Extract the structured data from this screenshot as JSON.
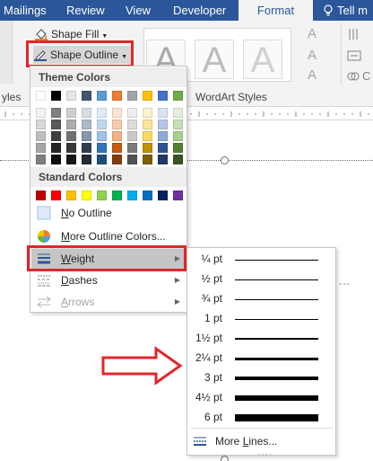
{
  "ribbon_tabs": [
    {
      "label": "Mailings",
      "active": false
    },
    {
      "label": "Review",
      "active": false
    },
    {
      "label": "View",
      "active": false
    },
    {
      "label": "Developer",
      "active": false
    },
    {
      "label": "Format",
      "active": true
    },
    {
      "label": "Tell m",
      "active": false
    }
  ],
  "ribbon": {
    "shape_fill_label": "Shape Fill",
    "shape_outline_label": "Shape Outline",
    "styles_group_label": "yles",
    "wordart_group_label": "WordArt Styles",
    "wordart_sample_letter": "A",
    "right_text_letter": "A",
    "right_align_letter": "C"
  },
  "theme_colors_header": "Theme Colors",
  "theme_colors_top": [
    "#ffffff",
    "#000000",
    "#e7e6e6",
    "#44546a",
    "#5b9bd5",
    "#ed7d31",
    "#a5a5a5",
    "#ffc000",
    "#4472c4",
    "#70ad47"
  ],
  "theme_colors_shades": [
    [
      "#f2f2f2",
      "#7f7f7f",
      "#d0cece",
      "#d6dce4",
      "#deebf6",
      "#fbe5d5",
      "#ededed",
      "#fff2cc",
      "#dae3f3",
      "#e2efd9"
    ],
    [
      "#d8d8d8",
      "#595959",
      "#aeabab",
      "#adb9ca",
      "#bdd7ee",
      "#f7cbac",
      "#dbdbdb",
      "#fee599",
      "#b4c6e7",
      "#c5e0b3"
    ],
    [
      "#bfbfbf",
      "#3f3f3f",
      "#757070",
      "#8496b0",
      "#9dc3e6",
      "#f4b183",
      "#c9c9c9",
      "#ffd965",
      "#8eaadb",
      "#a8d08d"
    ],
    [
      "#a5a5a5",
      "#262626",
      "#3a3838",
      "#323f4f",
      "#2e75b5",
      "#c55a11",
      "#7b7b7b",
      "#bf9000",
      "#2f5496",
      "#538135"
    ],
    [
      "#7f7f7f",
      "#0c0c0c",
      "#171616",
      "#222a35",
      "#1e4e79",
      "#843c0b",
      "#525252",
      "#7f6000",
      "#1f3864",
      "#375623"
    ]
  ],
  "standard_colors_header": "Standard Colors",
  "standard_colors": [
    "#c00000",
    "#ff0000",
    "#ffc000",
    "#ffff00",
    "#92d050",
    "#00b050",
    "#00b0f0",
    "#0070c0",
    "#002060",
    "#7030a0"
  ],
  "menu_items": {
    "no_outline": "No Outline",
    "more_outline_colors": "More Outline Colors...",
    "weight": "Weight",
    "dashes": "Dashes",
    "arrows": "Arrows"
  },
  "weights": [
    {
      "label": "¼ pt",
      "pt": 0.25
    },
    {
      "label": "½ pt",
      "pt": 0.5
    },
    {
      "label": "¾ pt",
      "pt": 0.75
    },
    {
      "label": "1 pt",
      "pt": 1
    },
    {
      "label": "1½ pt",
      "pt": 1.5
    },
    {
      "label": "2¼ pt",
      "pt": 2.25
    },
    {
      "label": "3 pt",
      "pt": 3
    },
    {
      "label": "4½ pt",
      "pt": 4.5
    },
    {
      "label": "6 pt",
      "pt": 6
    }
  ],
  "more_lines": "More Lines...",
  "accent_blue": "#2b579a",
  "highlight_red": "#e3262b"
}
